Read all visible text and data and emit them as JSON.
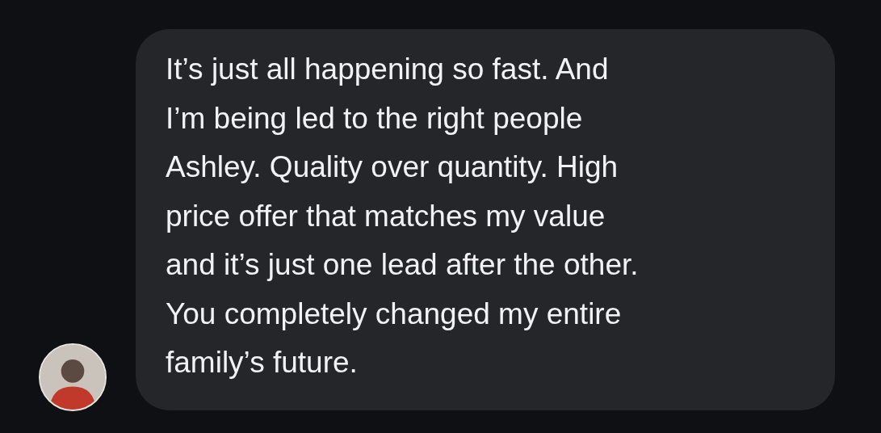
{
  "message": {
    "lines": [
      "It’s just all happening so fast. And",
      "I’m being led to the right people",
      "Ashley. Quality over quantity. High",
      "price offer that matches my value",
      "and it’s just one lead after the other.",
      "You completely changed my entire",
      "family’s future."
    ]
  }
}
